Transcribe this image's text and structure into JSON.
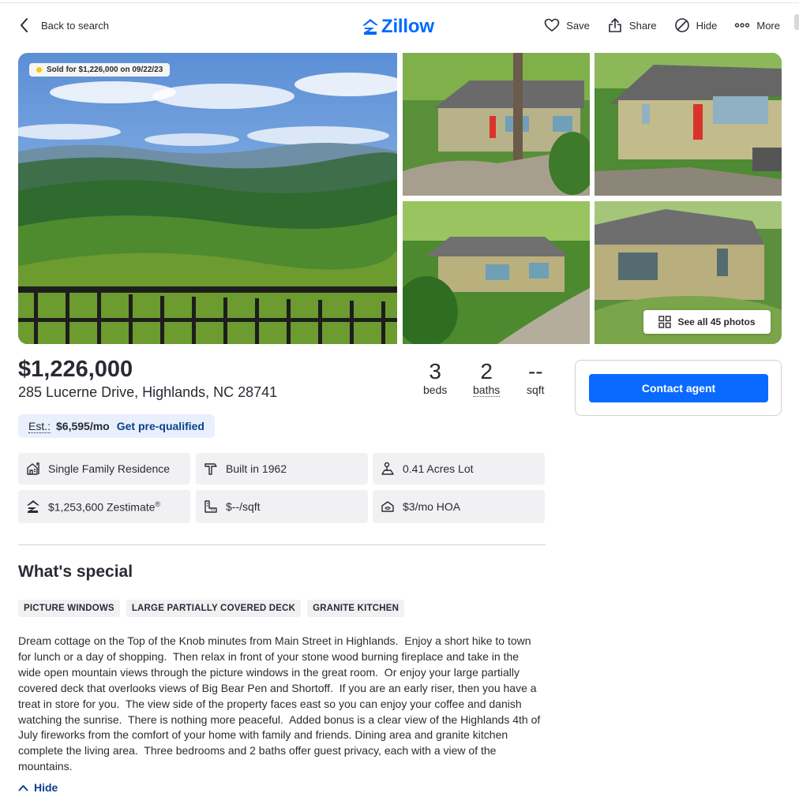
{
  "header": {
    "back_label": "Back to search",
    "logo_text": "Zillow",
    "actions": {
      "save": "Save",
      "share": "Share",
      "hide": "Hide",
      "more": "More"
    }
  },
  "gallery": {
    "sold_badge": "Sold for $1,226,000 on 09/22/23",
    "see_all": "See all 45 photos"
  },
  "listing": {
    "price": "$1,226,000",
    "address": "285 Lucerne Drive, Highlands, NC 28741",
    "beds": {
      "value": "3",
      "label": "beds"
    },
    "baths": {
      "value": "2",
      "label": "baths"
    },
    "sqft": {
      "value": "--",
      "label": "sqft"
    }
  },
  "contact": {
    "button": "Contact agent"
  },
  "estimate": {
    "label": "Est.:",
    "value": "$6,595/mo",
    "link": "Get pre-qualified"
  },
  "facts": {
    "type": "Single Family Residence",
    "built": "Built in 1962",
    "lot": "0.41 Acres Lot",
    "zestimate": "$1,253,600 Zestimate",
    "zestimate_mark": "®",
    "price_sqft": "$--/sqft",
    "hoa": "$3/mo HOA"
  },
  "special": {
    "title": "What's special",
    "tags": [
      "PICTURE WINDOWS",
      "LARGE PARTIALLY COVERED DECK",
      "GRANITE KITCHEN"
    ],
    "description": "Dream cottage on the Top of the Knob minutes from Main Street in Highlands.  Enjoy a short hike to town\nfor lunch or a day of shopping.  Then relax in front of your stone wood burning fireplace and take in the\nwide open mountain views through the picture windows in the great room.  Or enjoy your large partially\ncovered deck that overlooks views of Big Bear Pen and Shortoff.  If you are an early riser, then you have a\ntreat in store for you.  The view side of the property faces east so you can enjoy your coffee and danish\nwatching the sunrise.  There is nothing more peaceful.  Added bonus is a clear view of the Highlands 4th of\nJuly fireworks from the comfort of your home with family and friends. Dining area and granite kitchen\ncomplete the living area.  Three bedrooms and 2 baths offer guest privacy, each with a view of the\nmountains.",
    "hide_label": "Hide"
  },
  "colors": {
    "brand_blue": "#006aff",
    "button_blue": "#0a6aff",
    "link_navy": "#0d3f8e",
    "chip_bg": "#f1f1f4",
    "estimate_bg": "#e8f0fd",
    "sold_dot": "#f6c90e"
  },
  "icons": {
    "back": "chevron-left-icon",
    "logo": "zillow-logo-icon",
    "save": "heart-icon",
    "share": "share-icon",
    "hide": "hide-icon",
    "more": "more-dots-icon",
    "see_all": "grid-icon",
    "type": "house-icon",
    "built": "hammer-icon",
    "lot": "lot-icon",
    "zestimate": "zestimate-icon",
    "price_sqft": "ruler-icon",
    "hoa": "hoa-icon",
    "hide_toggle": "chevron-up-icon"
  }
}
